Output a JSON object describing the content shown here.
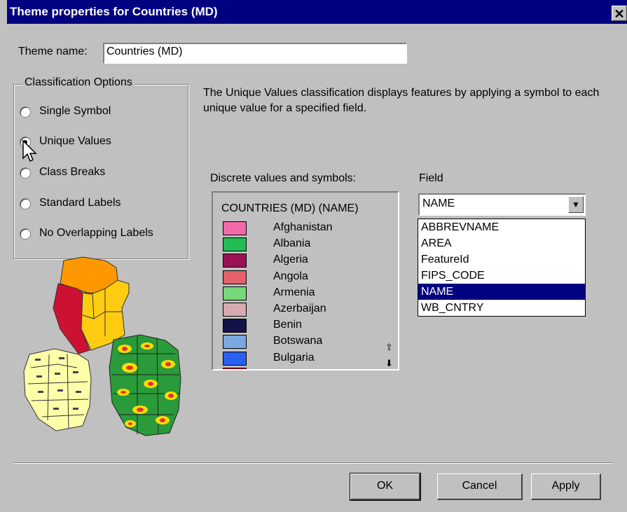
{
  "window": {
    "title": "Theme properties for Countries (MD)",
    "close_glyph": "✕"
  },
  "theme_name": {
    "label": "Theme name:",
    "value": "Countries (MD)"
  },
  "classification": {
    "group_title": "Classification Options",
    "options": [
      {
        "label": "Single Symbol",
        "selected": false
      },
      {
        "label": "Unique Values",
        "selected": true
      },
      {
        "label": "Class Breaks",
        "selected": false
      },
      {
        "label": "Standard Labels",
        "selected": false
      },
      {
        "label": "No Overlapping Labels",
        "selected": false
      }
    ]
  },
  "description": "The Unique Values classification displays features by applying a symbol to each unique value for a specified field.",
  "legend": {
    "label": "Discrete values and symbols:",
    "header": "COUNTRIES (MD) (NAME)",
    "items": [
      {
        "label": "Afghanistan",
        "color": "#f06aa8"
      },
      {
        "label": "Albania",
        "color": "#22bb55"
      },
      {
        "label": "Algeria",
        "color": "#9b1156"
      },
      {
        "label": "Angola",
        "color": "#e4606a"
      },
      {
        "label": "Armenia",
        "color": "#77d87a"
      },
      {
        "label": "Azerbaijan",
        "color": "#d8aab0"
      },
      {
        "label": "Benin",
        "color": "#14124a"
      },
      {
        "label": "Botswana",
        "color": "#7aa8e0"
      },
      {
        "label": "Bulgaria",
        "color": "#2a60f0"
      }
    ]
  },
  "field": {
    "label": "Field",
    "selected": "NAME",
    "options": [
      "ABBREVNAME",
      "AREA",
      "FeatureId",
      "FIPS_CODE",
      "NAME",
      "WB_CNTRY"
    ]
  },
  "buttons": {
    "ok": "OK",
    "cancel": "Cancel",
    "apply": "Apply"
  }
}
